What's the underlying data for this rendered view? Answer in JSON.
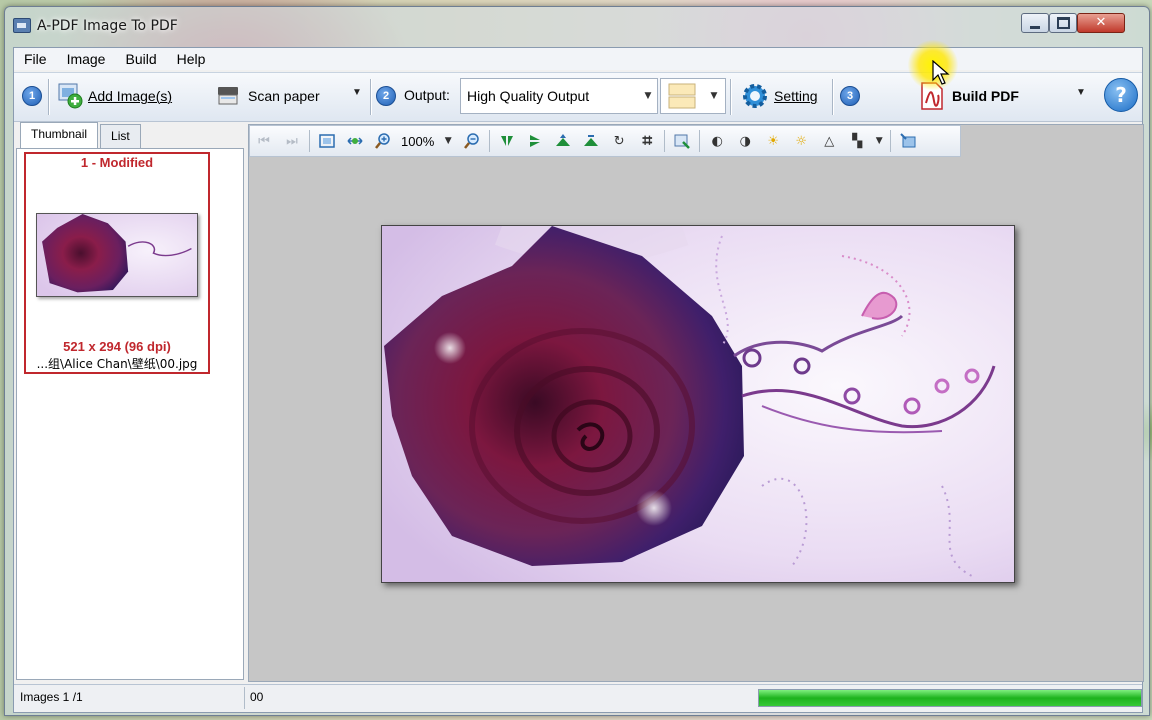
{
  "window": {
    "title": "A-PDF Image To PDF"
  },
  "menu": [
    "File",
    "Image",
    "Build",
    "Help"
  ],
  "toolbar": {
    "step1": "1",
    "add_images": "Add Image(s)",
    "scan_paper": "Scan paper",
    "step2": "2",
    "output_label": "Output:",
    "output_value": "High Quality Output",
    "setting": "Setting",
    "step3": "3",
    "build_pdf": "Build PDF",
    "help": "?"
  },
  "tabs": [
    "Thumbnail",
    "List"
  ],
  "thumbnail": {
    "title": "1 - Modified",
    "dims": "521 x 294 (96 dpi)",
    "path": "...组\\Alice Chan\\壁纸\\00.jpg"
  },
  "image_toolbar": {
    "zoom": "100%"
  },
  "status": {
    "images": "Images 1 /1",
    "info": "00",
    "progress": 1.0
  },
  "colors": {
    "accent": "#c0272d",
    "progress": "#1db31d",
    "canvas": "#c6c6c6"
  }
}
